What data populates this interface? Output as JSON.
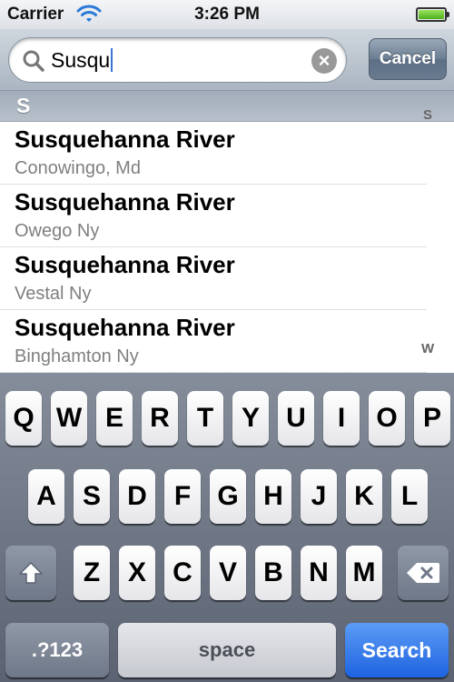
{
  "status_bar": {
    "carrier": "Carrier",
    "time": "3:26 PM"
  },
  "search": {
    "value": "Susqu",
    "cancel_label": "Cancel"
  },
  "section": {
    "header": "S"
  },
  "results": [
    {
      "title": "Susquehanna River",
      "subtitle": "Conowingo, Md"
    },
    {
      "title": "Susquehanna River",
      "subtitle": "Owego Ny"
    },
    {
      "title": "Susquehanna River",
      "subtitle": "Vestal Ny"
    },
    {
      "title": "Susquehanna River",
      "subtitle": "Binghamton Ny"
    }
  ],
  "index": [
    "S",
    "W"
  ],
  "keyboard": {
    "row1": [
      "Q",
      "W",
      "E",
      "R",
      "T",
      "Y",
      "U",
      "I",
      "O",
      "P"
    ],
    "row2": [
      "A",
      "S",
      "D",
      "F",
      "G",
      "H",
      "J",
      "K",
      "L"
    ],
    "row3": [
      "Z",
      "X",
      "C",
      "V",
      "B",
      "N",
      "M"
    ],
    "mode_label": ".?123",
    "space_label": "space",
    "search_label": "Search"
  },
  "colors": {
    "accent": "#2a6ee6",
    "caret": "#3a75d6",
    "subtitle": "#7f7f7f"
  },
  "icons": [
    "wifi-icon",
    "battery-icon",
    "search-icon",
    "clear-icon",
    "shift-icon",
    "backspace-icon"
  ]
}
